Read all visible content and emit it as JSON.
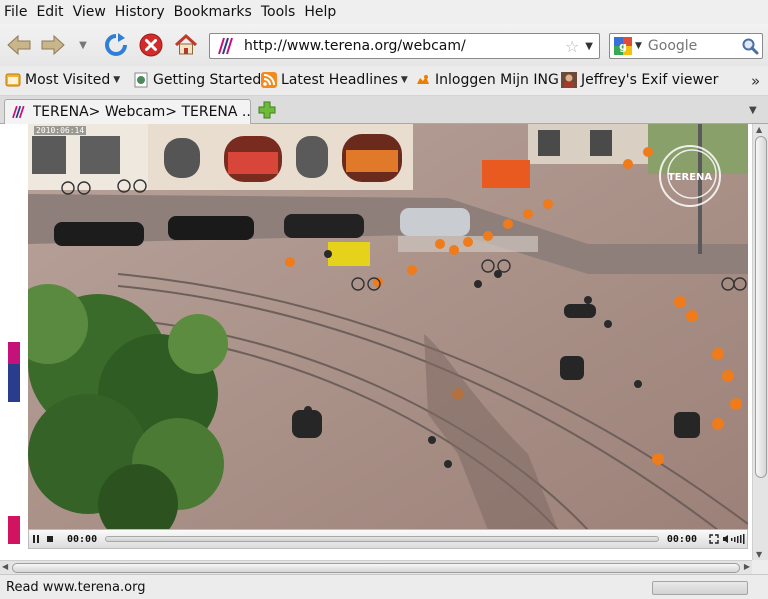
{
  "menu": {
    "items": [
      {
        "label": "File",
        "name": "menu-file"
      },
      {
        "label": "Edit",
        "name": "menu-edit"
      },
      {
        "label": "View",
        "name": "menu-view"
      },
      {
        "label": "History",
        "name": "menu-history"
      },
      {
        "label": "Bookmarks",
        "name": "menu-bookmarks"
      },
      {
        "label": "Tools",
        "name": "menu-tools"
      },
      {
        "label": "Help",
        "name": "menu-help"
      }
    ]
  },
  "navigation": {
    "url": "http://www.terena.org/webcam/",
    "search_placeholder": "Google",
    "icons": [
      "back-arrow-icon",
      "forward-arrow-icon",
      "history-dropdown-icon",
      "reload-icon",
      "stop-icon",
      "home-icon",
      "bookmark-star-icon",
      "url-dropdown-icon",
      "google-icon",
      "search-magnifier-icon"
    ]
  },
  "bookmarks": {
    "items": [
      {
        "label": "Most Visited",
        "icon": "most-visited-icon",
        "has_menu": true
      },
      {
        "label": "Getting Started",
        "icon": "getting-started-icon",
        "has_menu": false
      },
      {
        "label": "Latest Headlines",
        "icon": "rss-feed-icon",
        "has_menu": true
      },
      {
        "label": "Inloggen Mijn ING",
        "icon": "ing-lion-icon",
        "has_menu": false
      },
      {
        "label": "Jeffrey's Exif viewer",
        "icon": "exif-viewer-icon",
        "has_menu": false
      }
    ],
    "overflow_glyph": "»"
  },
  "tabs": {
    "items": [
      {
        "title": "TERENA> Webcam> TERENA ...",
        "active": true
      }
    ],
    "new_tab_glyph": "+"
  },
  "content": {
    "webcam": {
      "timestamp": "2010:06:14",
      "watermark": "TERENA"
    },
    "player": {
      "current_time": "00:00",
      "total_time": "00:00",
      "progress": 0
    }
  },
  "status": {
    "text": "Read www.terena.org"
  },
  "colors": {
    "terena_magenta": "#c4127a",
    "terena_blue": "#2a3c8c",
    "stop_red": "#d12b2b",
    "reload_blue": "#2f7fd6"
  }
}
